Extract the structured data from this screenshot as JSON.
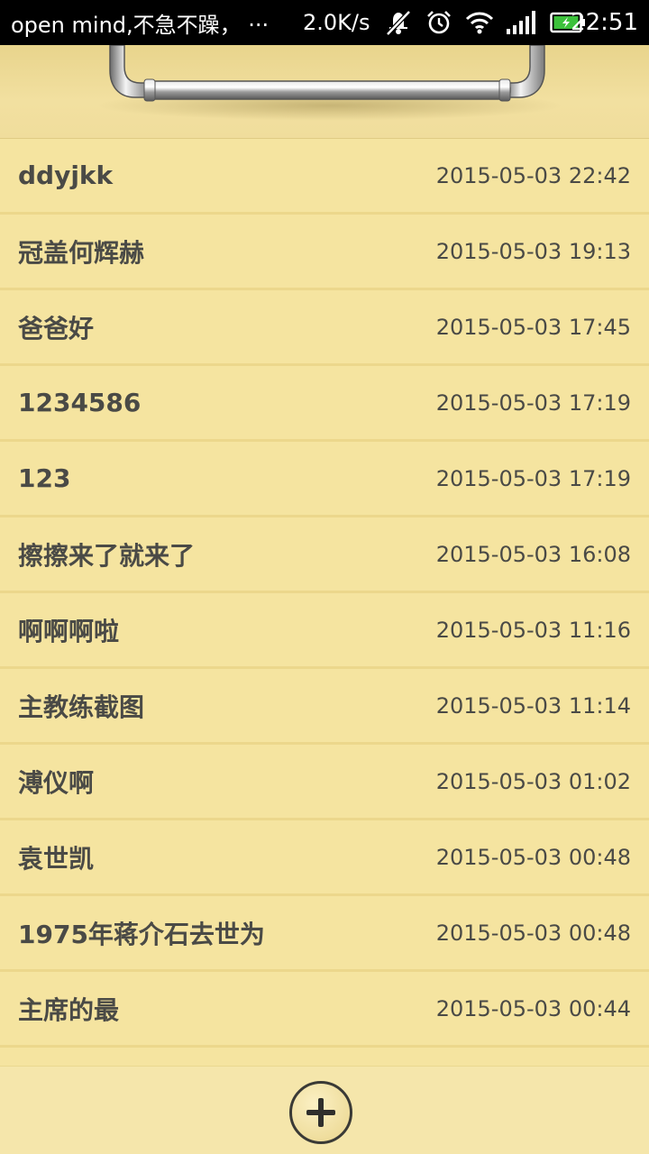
{
  "status_bar": {
    "notification": "open mind,不急不躁，  ···",
    "net_speed": "2.0K/s",
    "time": "22:51",
    "icons": [
      "mute-icon",
      "alarm-icon",
      "wifi-icon",
      "signal-icon",
      "battery-icon"
    ]
  },
  "notes": [
    {
      "title": "ddyjkk",
      "time": "2015-05-03 22:42"
    },
    {
      "title": "冠盖何辉赫",
      "time": "2015-05-03 19:13"
    },
    {
      "title": "爸爸好",
      "time": "2015-05-03 17:45"
    },
    {
      "title": "1234586",
      "time": "2015-05-03 17:19"
    },
    {
      "title": "123",
      "time": "2015-05-03 17:19"
    },
    {
      "title": "擦擦来了就来了",
      "time": "2015-05-03 16:08"
    },
    {
      "title": "啊啊啊啦",
      "time": "2015-05-03 11:16"
    },
    {
      "title": "主教练截图",
      "time": "2015-05-03 11:14"
    },
    {
      "title": "溥仪啊",
      "time": "2015-05-03 01:02"
    },
    {
      "title": "袁世凯",
      "time": "2015-05-03 00:48"
    },
    {
      "title": "1975年蒋介石去世为",
      "time": "2015-05-03 00:48"
    },
    {
      "title": "主席的最",
      "time": "2015-05-03 00:44"
    }
  ],
  "colors": {
    "paper": "#f5e4a0",
    "divider": "#ecd78c",
    "text": "#4a4a46",
    "status_bar": "#000000",
    "battery": "#3cc13b"
  },
  "bottom_bar": {
    "add_icon": "plus-circle-icon"
  }
}
